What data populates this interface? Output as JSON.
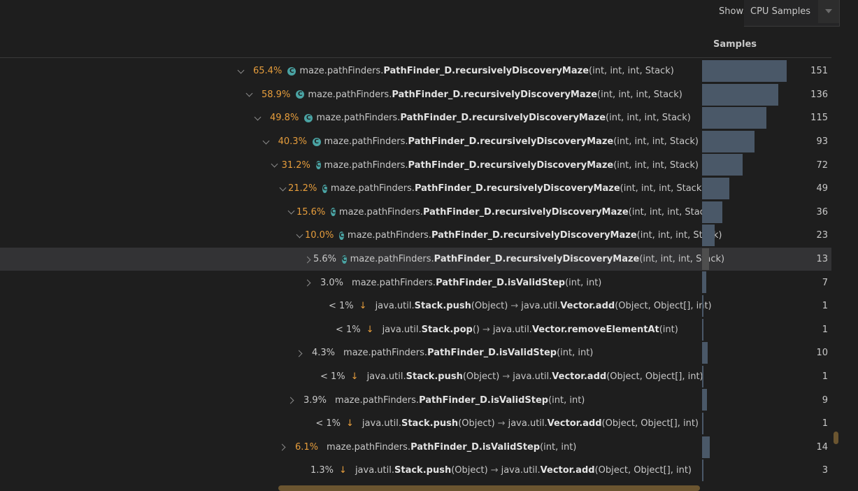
{
  "toolbar": {
    "show_label": "Show:",
    "show_value": "CPU Samples"
  },
  "header": {
    "samples_label": "Samples"
  },
  "max_samples": 151,
  "rows": [
    {
      "chev": "down",
      "pct": "65.4%",
      "hot": true,
      "icon": true,
      "kind": "method",
      "pkg": "maze.pathFinders.",
      "cls": "PathFinder_D.recursivelyDiscoveryMaze",
      "args": "(int, int, int, Stack)",
      "samples": 151
    },
    {
      "chev": "down",
      "pct": "58.9%",
      "hot": true,
      "icon": true,
      "kind": "method",
      "pkg": "maze.pathFinders.",
      "cls": "PathFinder_D.recursivelyDiscoveryMaze",
      "args": "(int, int, int, Stack)",
      "samples": 136
    },
    {
      "chev": "down",
      "pct": "49.8%",
      "hot": true,
      "icon": true,
      "kind": "method",
      "pkg": "maze.pathFinders.",
      "cls": "PathFinder_D.recursivelyDiscoveryMaze",
      "args": "(int, int, int, Stack)",
      "samples": 115
    },
    {
      "chev": "down",
      "pct": "40.3%",
      "hot": true,
      "icon": true,
      "kind": "method",
      "pkg": "maze.pathFinders.",
      "cls": "PathFinder_D.recursivelyDiscoveryMaze",
      "args": "(int, int, int, Stack)",
      "samples": 93
    },
    {
      "chev": "down",
      "pct": "31.2%",
      "hot": true,
      "icon": true,
      "kind": "method",
      "pkg": "maze.pathFinders.",
      "cls": "PathFinder_D.recursivelyDiscoveryMaze",
      "args": "(int, int, int, Stack)",
      "samples": 72
    },
    {
      "chev": "down",
      "pct": "21.2%",
      "hot": true,
      "icon": true,
      "kind": "method",
      "pkg": "maze.pathFinders.",
      "cls": "PathFinder_D.recursivelyDiscoveryMaze",
      "args": "(int, int, int, Stack)",
      "samples": 49
    },
    {
      "chev": "down",
      "pct": "15.6%",
      "hot": true,
      "icon": true,
      "kind": "method",
      "pkg": "maze.pathFinders.",
      "cls": "PathFinder_D.recursivelyDiscoveryMaze",
      "args": "(int, int, int, Stack)",
      "samples": 36
    },
    {
      "chev": "down",
      "pct": "10.0%",
      "hot": true,
      "icon": true,
      "kind": "method",
      "pkg": "maze.pathFinders.",
      "cls": "PathFinder_D.recursivelyDiscoveryMaze",
      "args": "(int, int, int, Stack)",
      "samples": 23
    },
    {
      "chev": "right",
      "pct": "5.6%",
      "hot": false,
      "icon": true,
      "kind": "method",
      "pkg": "maze.pathFinders.",
      "cls": "PathFinder_D.recursivelyDiscoveryMaze",
      "args": "(int, int, int, Stack)",
      "samples": 13,
      "selected": true
    },
    {
      "chev": "right",
      "pct": "3.0%",
      "hot": false,
      "icon": false,
      "kind": "method",
      "pkg": "maze.pathFinders.",
      "cls": "PathFinder_D.isValidStep",
      "args": "(int, int)",
      "samples": 7
    },
    {
      "chev": "none",
      "pct": "< 1%",
      "hot": false,
      "icon": false,
      "kind": "native",
      "pkg": "java.util.",
      "cls": "Stack.push",
      "args": "(Object)",
      "tpkg": "java.util.",
      "tcls": "Vector.add",
      "targs": "(Object, Object[], int)",
      "samples": 1
    },
    {
      "chev": "none",
      "pct": "< 1%",
      "hot": false,
      "icon": false,
      "kind": "native",
      "pkg": "java.util.",
      "cls": "Stack.pop",
      "args": "()",
      "tpkg": "java.util.",
      "tcls": "Vector.removeElementAt",
      "targs": "(int)",
      "samples": 1
    },
    {
      "chev": "right",
      "pct": "4.3%",
      "hot": false,
      "icon": false,
      "kind": "method",
      "pkg": "maze.pathFinders.",
      "cls": "PathFinder_D.isValidStep",
      "args": "(int, int)",
      "samples": 10
    },
    {
      "chev": "none",
      "pct": "< 1%",
      "hot": false,
      "icon": false,
      "kind": "native",
      "pkg": "java.util.",
      "cls": "Stack.push",
      "args": "(Object)",
      "tpkg": "java.util.",
      "tcls": "Vector.add",
      "targs": "(Object, Object[], int)",
      "samples": 1
    },
    {
      "chev": "right",
      "pct": "3.9%",
      "hot": false,
      "icon": false,
      "kind": "method",
      "pkg": "maze.pathFinders.",
      "cls": "PathFinder_D.isValidStep",
      "args": "(int, int)",
      "samples": 9
    },
    {
      "chev": "none",
      "pct": "< 1%",
      "hot": false,
      "icon": false,
      "kind": "native",
      "pkg": "java.util.",
      "cls": "Stack.push",
      "args": "(Object)",
      "tpkg": "java.util.",
      "tcls": "Vector.add",
      "targs": "(Object, Object[], int)",
      "samples": 1
    },
    {
      "chev": "right",
      "pct": "6.1%",
      "hot": true,
      "icon": false,
      "kind": "method",
      "pkg": "maze.pathFinders.",
      "cls": "PathFinder_D.isValidStep",
      "args": "(int, int)",
      "samples": 14
    },
    {
      "chev": "none",
      "pct": "1.3%",
      "hot": false,
      "icon": false,
      "kind": "native",
      "pkg": "java.util.",
      "cls": "Stack.push",
      "args": "(Object)",
      "tpkg": "java.util.",
      "tcls": "Vector.add",
      "targs": "(Object, Object[], int)",
      "samples": 3
    }
  ],
  "colors": {
    "hot": "#e69d3c",
    "bar": "#4a5868",
    "icon": "#4aa3a3"
  }
}
